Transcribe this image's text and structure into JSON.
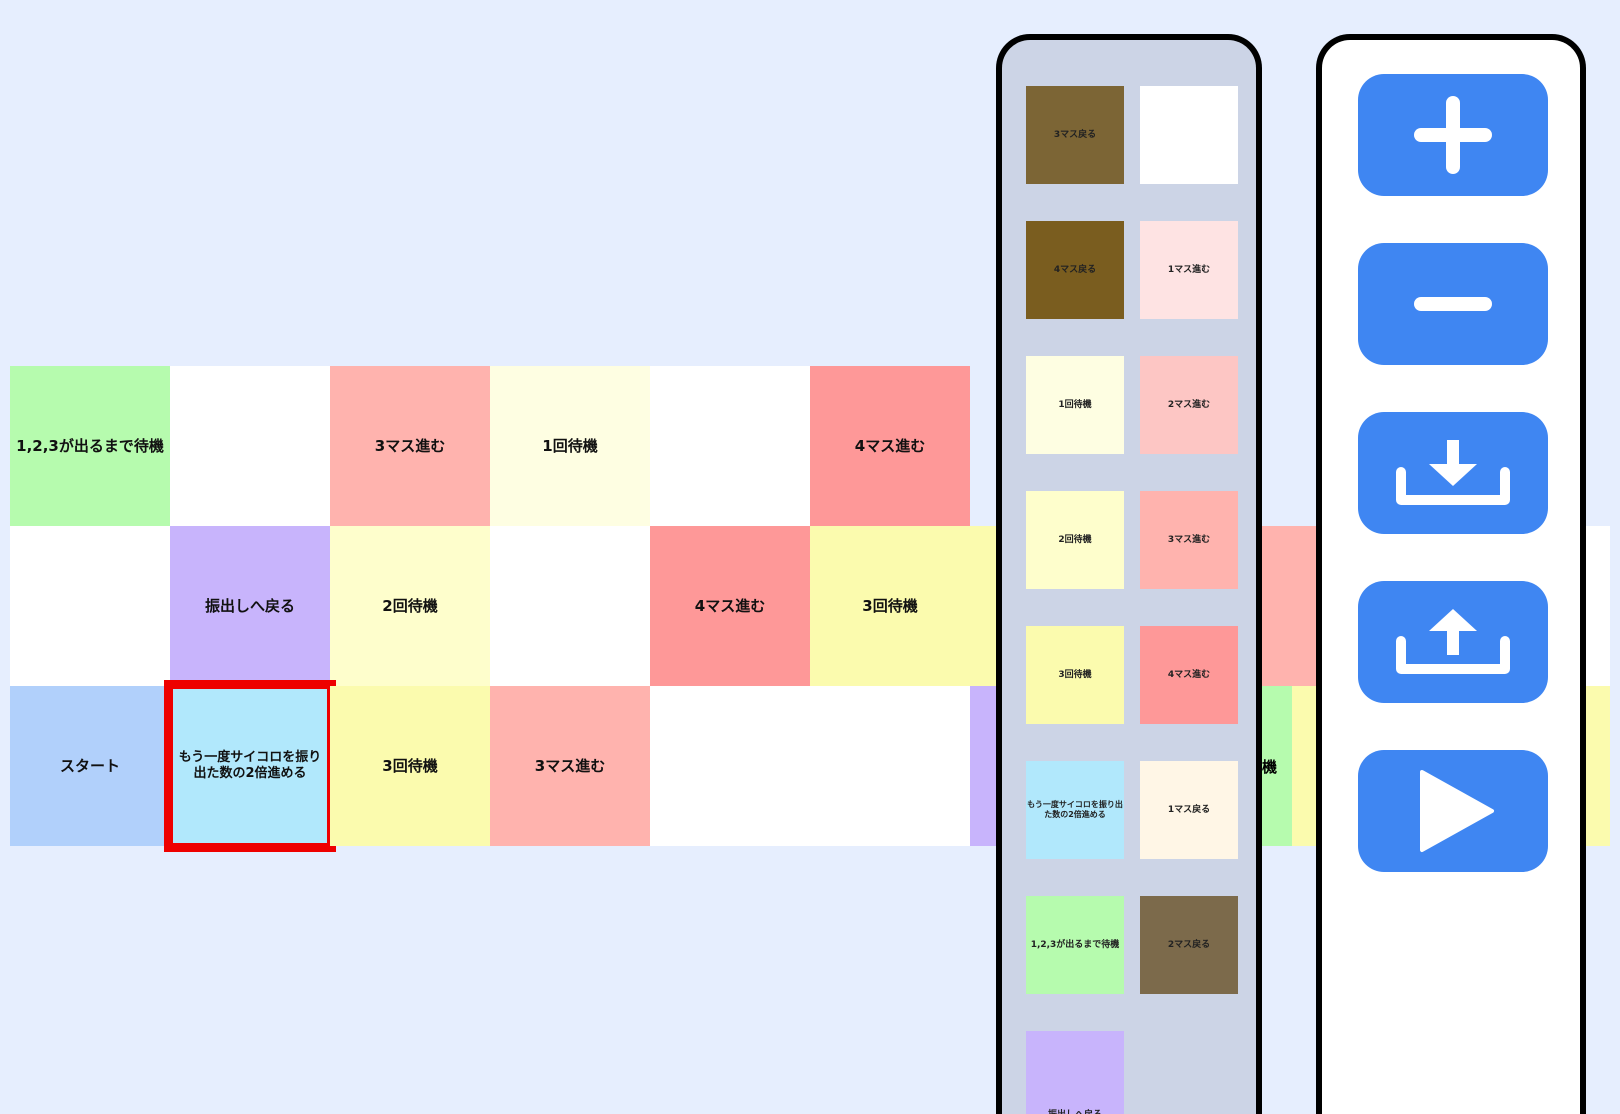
{
  "board": {
    "rows": [
      [
        {
          "label": "1,2,3が出るまで待機",
          "color": "#b6fbae"
        },
        {
          "label": "",
          "color": "#ffffff"
        },
        {
          "label": "3マス進む",
          "color": "#ffb3ae"
        },
        {
          "label": "1回待機",
          "color": "#fefee2"
        },
        {
          "label": "",
          "color": "#ffffff"
        },
        {
          "label": "4マス進む",
          "color": "#fe9898"
        }
      ],
      [
        {
          "label": "",
          "color": "#ffffff"
        },
        {
          "label": "振出しへ戻る",
          "color": "#c8b4fc"
        },
        {
          "label": "2回待機",
          "color": "#fefecc"
        },
        {
          "label": "",
          "color": "#ffffff"
        },
        {
          "label": "4マス進む",
          "color": "#fe9898"
        },
        {
          "label": "3回待機",
          "color": "#fbfbae"
        }
      ],
      [
        {
          "label": "スタート",
          "color": "#b1d0fb"
        },
        {
          "label": "もう一度サイコロを振り出た数の2倍進める",
          "color": "#b1e8fc"
        },
        {
          "label": "3回待機",
          "color": "#fbfbae"
        },
        {
          "label": "3マス進む",
          "color": "#ffb3ae"
        },
        {
          "label": "",
          "color": "#ffffff"
        },
        {
          "label": "",
          "color": "#ffffff"
        }
      ]
    ],
    "selected_cell": "row3-col2",
    "selected_color": "#ee0000",
    "partial_right_label": "機"
  },
  "palette": {
    "items": [
      {
        "label": "3マス戻る",
        "color": "#7c6535"
      },
      {
        "label": "",
        "color": "#ffffff"
      },
      {
        "label": "4マス戻る",
        "color": "#7a5d1f"
      },
      {
        "label": "1マス進む",
        "color": "#fee3e3"
      },
      {
        "label": "1回待機",
        "color": "#fefee2"
      },
      {
        "label": "2マス進む",
        "color": "#fdc6c4"
      },
      {
        "label": "2回待機",
        "color": "#fefecc"
      },
      {
        "label": "3マス進む",
        "color": "#ffb3ae"
      },
      {
        "label": "3回待機",
        "color": "#fbfbae"
      },
      {
        "label": "4マス進む",
        "color": "#fe9898"
      },
      {
        "label": "もう一度サイコロを振り出た数の2倍進める",
        "color": "#b1e8fc"
      },
      {
        "label": "1マス戻る",
        "color": "#fff6e6"
      },
      {
        "label": "1,2,3が出るまで待機",
        "color": "#b6fbae"
      },
      {
        "label": "2マス戻る",
        "color": "#7c6a4b"
      },
      {
        "label": "振出しへ戻る",
        "color": "#c8b4fc"
      }
    ]
  },
  "toolbar": {
    "buttons": [
      {
        "icon": "plus-icon"
      },
      {
        "icon": "minus-icon"
      },
      {
        "icon": "download-icon"
      },
      {
        "icon": "upload-icon"
      },
      {
        "icon": "play-icon"
      }
    ],
    "button_color": "#3f86f2"
  }
}
